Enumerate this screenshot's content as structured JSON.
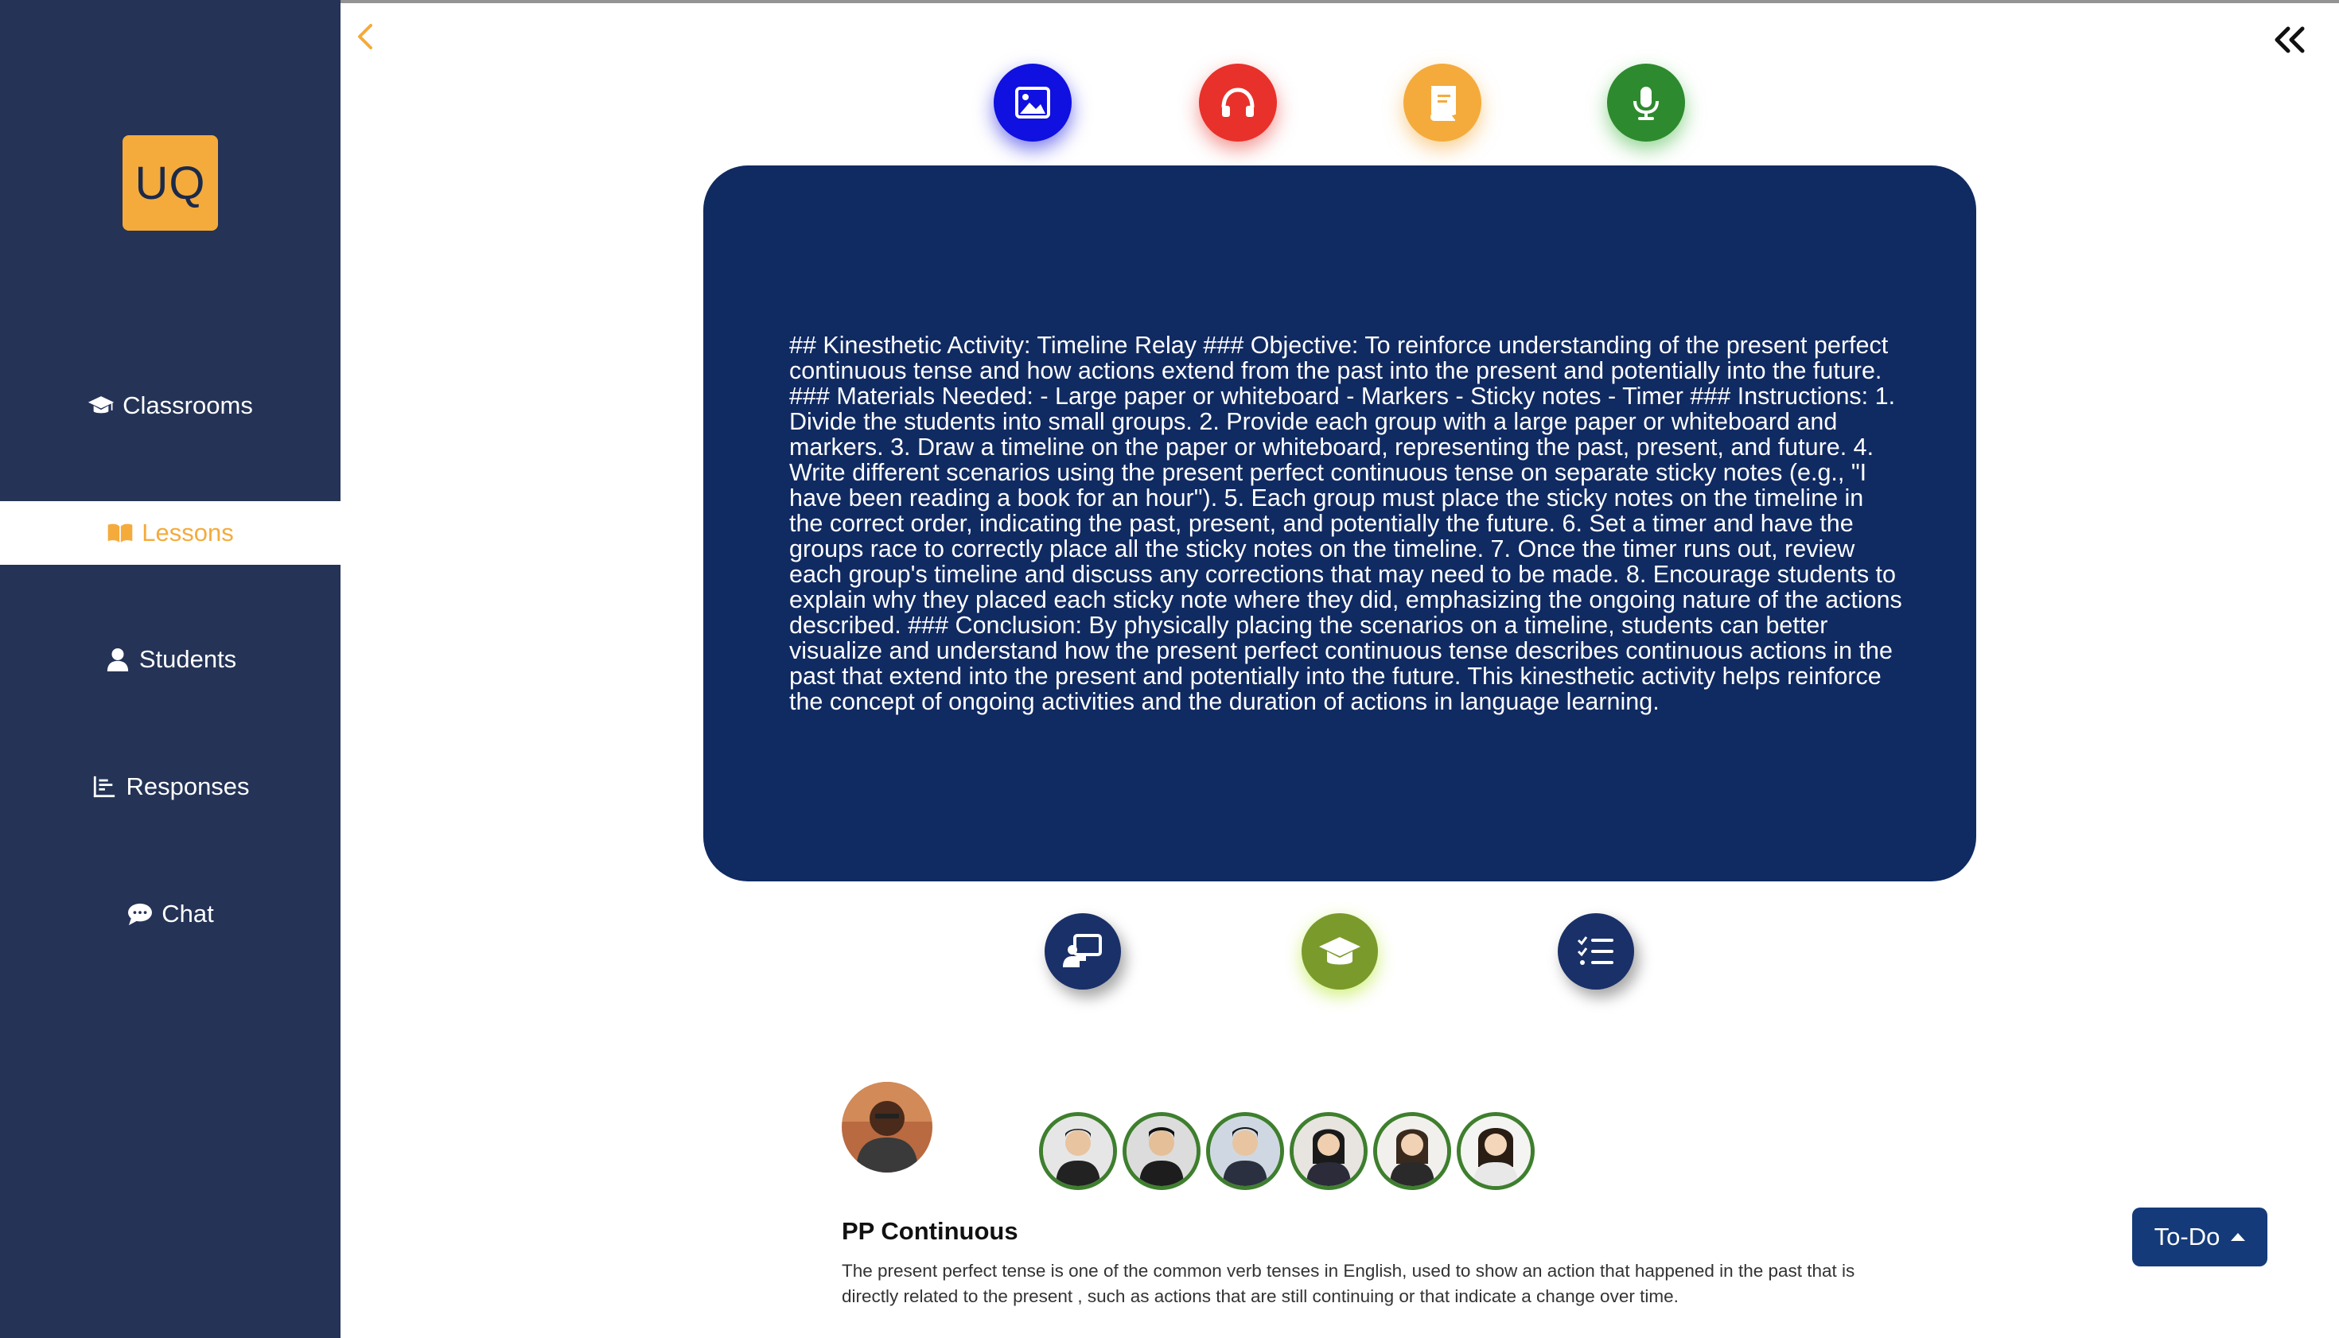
{
  "app": {
    "logo_text": "UQ"
  },
  "sidebar": {
    "items": [
      {
        "label": "Classrooms",
        "icon": "graduation-cap-icon",
        "active": false
      },
      {
        "label": "Lessons",
        "icon": "book-open-icon",
        "active": true
      },
      {
        "label": "Students",
        "icon": "user-icon",
        "active": false
      },
      {
        "label": "Responses",
        "icon": "bar-chart-icon",
        "active": false
      },
      {
        "label": "Chat",
        "icon": "chat-bubble-icon",
        "active": false
      }
    ]
  },
  "header": {
    "back_icon": "chevron-left-icon",
    "collapse_icon": "double-chevron-left-icon"
  },
  "media_modes": [
    {
      "name": "image",
      "icon": "image-icon",
      "color": "#1010e0"
    },
    {
      "name": "audio",
      "icon": "headphones-icon",
      "color": "#e8312a"
    },
    {
      "name": "reading",
      "icon": "book-icon",
      "color": "#f4ab3c"
    },
    {
      "name": "speaking",
      "icon": "microphone-icon",
      "color": "#2e8a2e"
    }
  ],
  "card": {
    "text": "## Kinesthetic Activity: Timeline Relay ### Objective: To reinforce understanding of the present perfect continuous tense and how actions extend from the past into the present and potentially into the future. ### Materials Needed: - Large paper or whiteboard - Markers - Sticky notes - Timer ### Instructions: 1. Divide the students into small groups. 2. Provide each group with a large paper or whiteboard and markers. 3. Draw a timeline on the paper or whiteboard, representing the past, present, and future. 4. Write different scenarios using the present perfect continuous tense on separate sticky notes (e.g., \"I have been reading a book for an hour\"). 5. Each group must place the sticky notes on the timeline in the correct order, indicating the past, present, and potentially the future. 6. Set a timer and have the groups race to correctly place all the sticky notes on the timeline. 7. Once the timer runs out, review each group's timeline and discuss any corrections that may need to be made. 8. Encourage students to explain why they placed each sticky note where they did, emphasizing the ongoing nature of the actions described. ### Conclusion: By physically placing the scenarios on a timeline, students can better visualize and understand how the present perfect continuous tense describes continuous actions in the past that extend into the present and potentially into the future. This kinesthetic activity helps reinforce the concept of ongoing activities and the duration of actions in language learning.",
    "color": "#102a62"
  },
  "tools": [
    {
      "name": "presentation",
      "icon": "teacher-board-icon",
      "color": "#1a3068"
    },
    {
      "name": "learning",
      "icon": "graduation-cap-icon",
      "color": "#7a9b2c"
    },
    {
      "name": "checklist",
      "icon": "task-list-icon",
      "color": "#1a3068"
    }
  ],
  "lesson": {
    "title": "PP Continuous",
    "description": "The present perfect tense is one of the common verb tenses in English, used to show an action that happened in the past that is directly related to the present , such as actions that are still continuing or that indicate a change over time."
  },
  "students_count": 6,
  "todo": {
    "label": "To-Do"
  }
}
